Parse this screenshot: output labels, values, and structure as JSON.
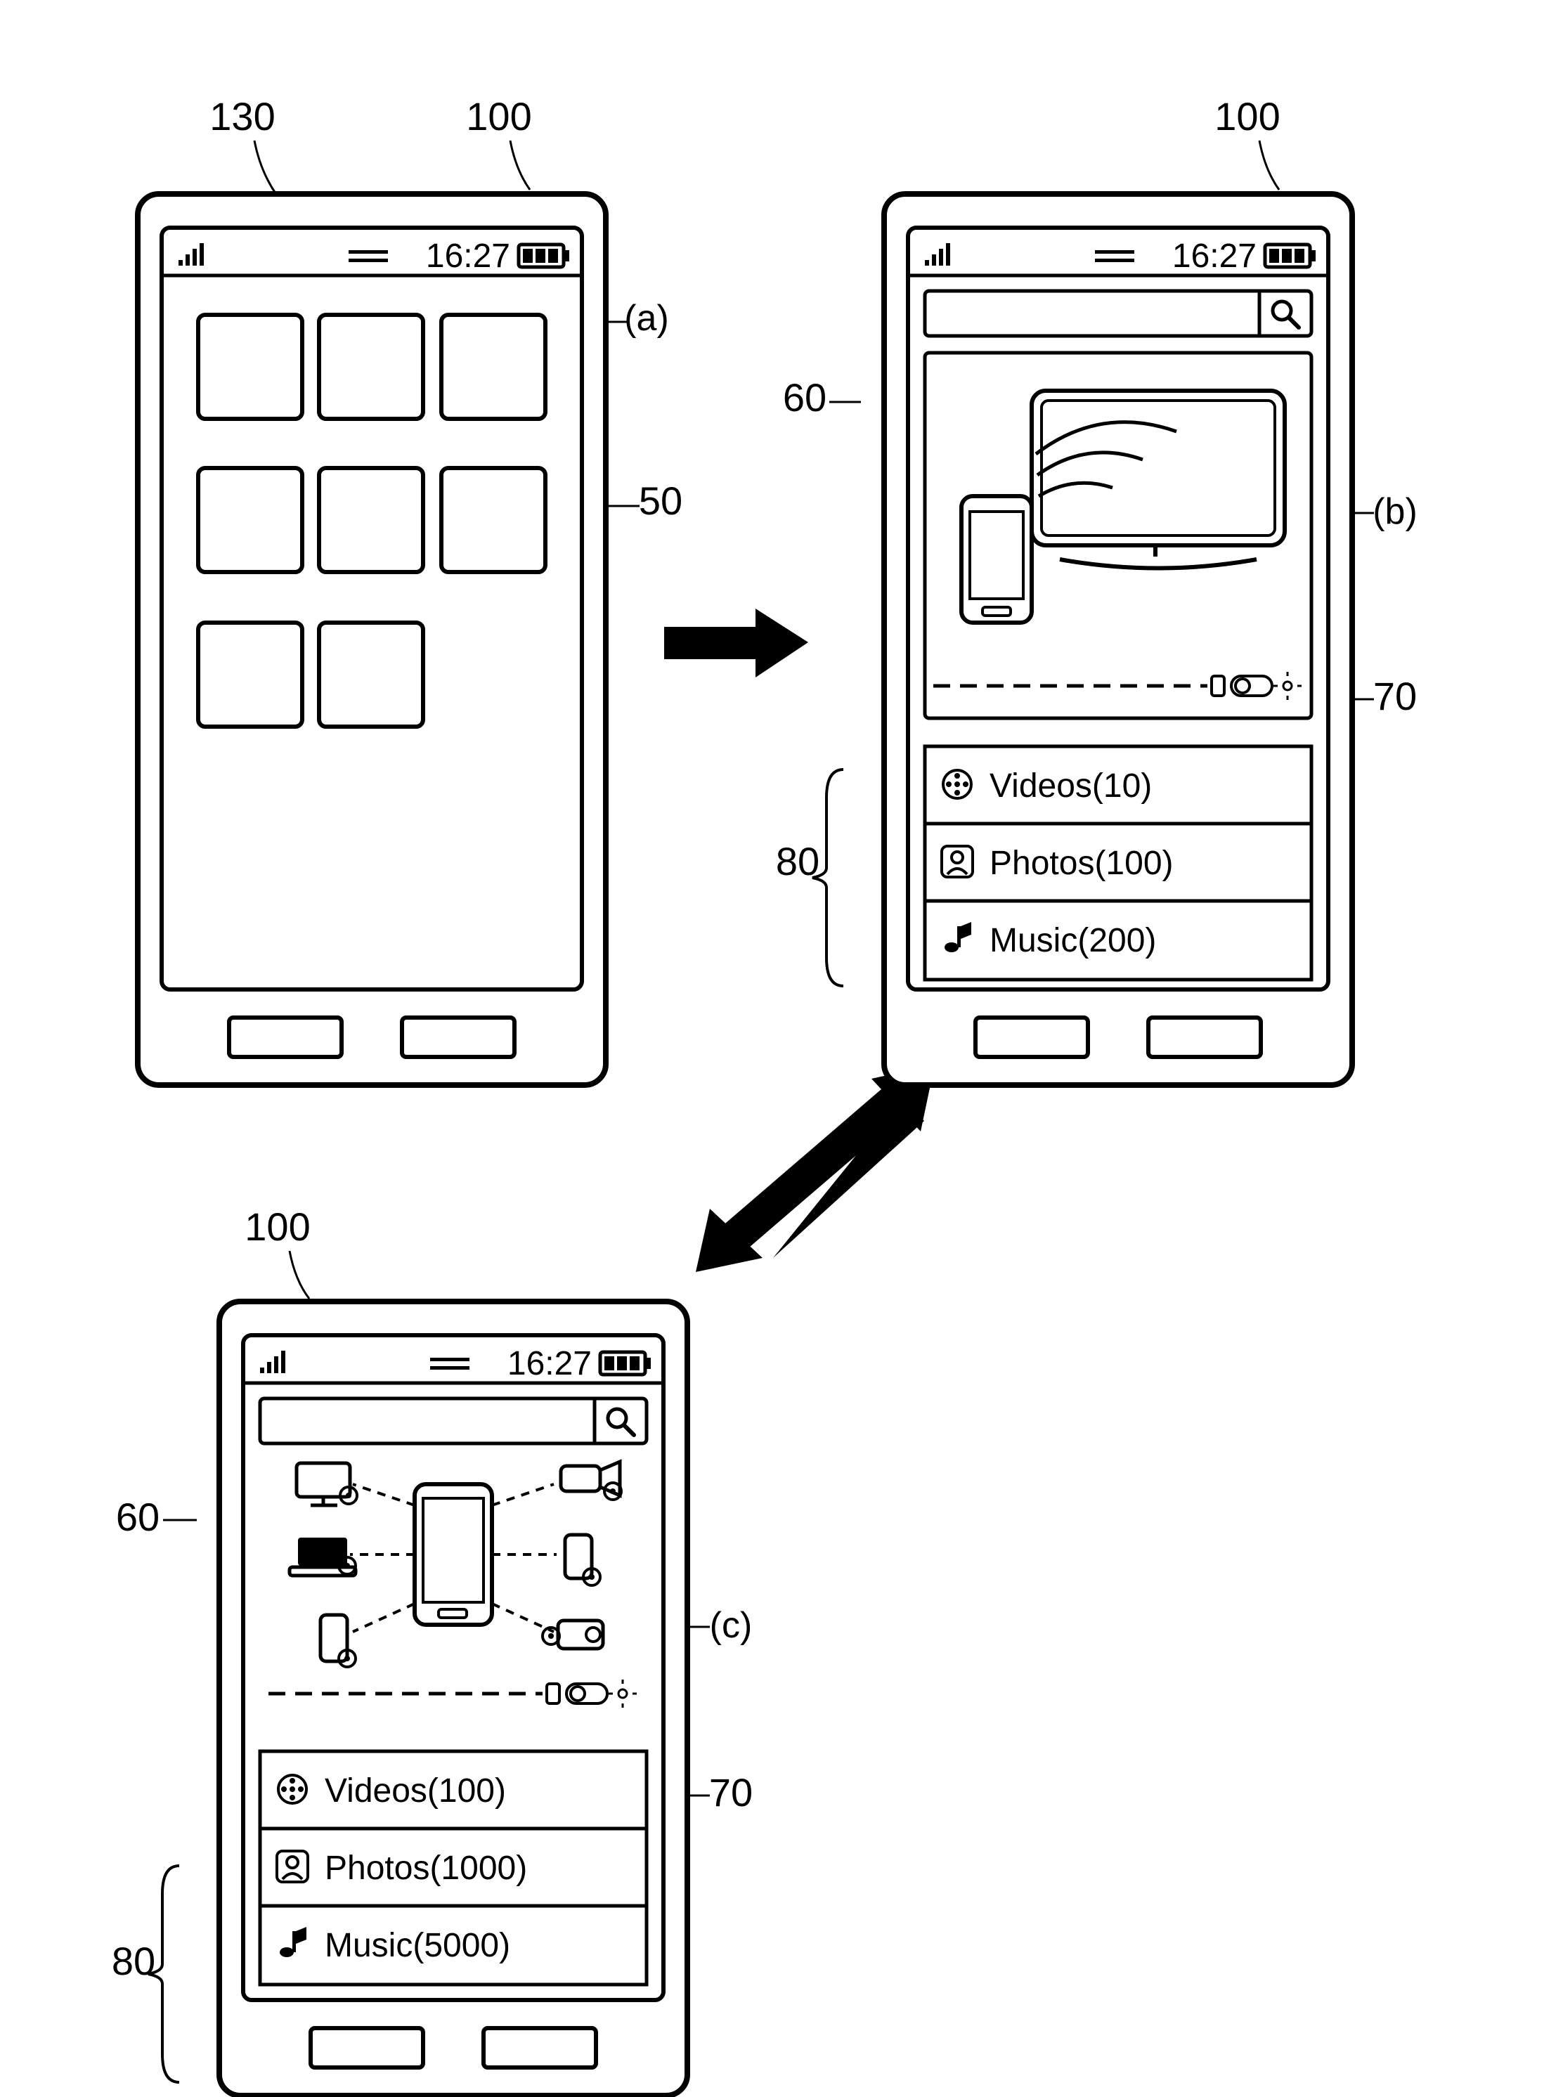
{
  "figure": {
    "refs": {
      "device": "100",
      "screen50": "50",
      "touchscreen": "130",
      "connectArea": "60",
      "toggle": "70",
      "categoryList": "80"
    },
    "panelLabels": {
      "a": "(a)",
      "b": "(b)",
      "c": "(c)"
    },
    "statusBar": {
      "time": "16:27"
    },
    "phoneB": {
      "categories": [
        {
          "label": "Videos(10)"
        },
        {
          "label": "Photos(100)"
        },
        {
          "label": "Music(200)"
        }
      ]
    },
    "phoneC": {
      "categories": [
        {
          "label": "Videos(100)"
        },
        {
          "label": "Photos(1000)"
        },
        {
          "label": "Music(5000)"
        }
      ]
    }
  }
}
